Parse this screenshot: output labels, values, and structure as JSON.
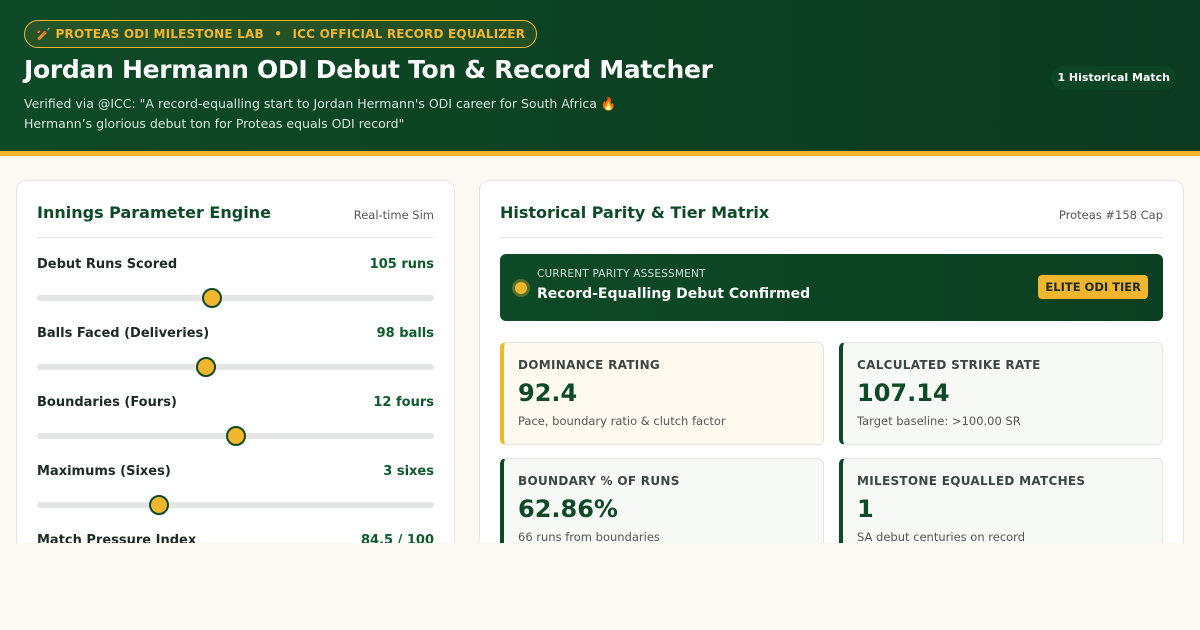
{
  "header": {
    "badge_icon": "🏏",
    "badge_left": "PROTEAS ODI MILESTONE LAB",
    "badge_sep": "•",
    "badge_right": "ICC OFFICIAL RECORD EQUALIZER",
    "title": "Jordan Hermann ODI Debut Ton & Record Matcher",
    "subtitle_line1": "Verified via @ICC: \"A record-equalling start to Jordan Hermann's ODI career for South Africa 🔥",
    "subtitle_line2": "Hermann’s glorious debut ton for Proteas equals ODI record\"",
    "match_count": "1 Historical Match"
  },
  "engine": {
    "title": "Innings Parameter Engine",
    "tag": "Real-time Sim",
    "params": [
      {
        "label": "Debut Runs Scored",
        "value": "105 runs",
        "fraction": 0.44
      },
      {
        "label": "Balls Faced (Deliveries)",
        "value": "98 balls",
        "fraction": 0.425
      },
      {
        "label": "Boundaries (Fours)",
        "value": "12 fours",
        "fraction": 0.5
      },
      {
        "label": "Maximums (Sixes)",
        "value": "3 sixes",
        "fraction": 0.307
      },
      {
        "label": "Match Pressure Index",
        "value": "84.5 / 100",
        "fraction": 0.845
      }
    ]
  },
  "matrix": {
    "title": "Historical Parity & Tier Matrix",
    "tag": "Proteas #158 Cap",
    "parity_label": "CURRENT PARITY ASSESSMENT",
    "parity_status": "Record-Equalling Debut Confirmed",
    "tier": "ELITE ODI TIER",
    "metrics": [
      {
        "label": "DOMINANCE RATING",
        "value": "92.4",
        "caption": "Pace, boundary ratio & clutch factor"
      },
      {
        "label": "CALCULATED STRIKE RATE",
        "value": "107.14",
        "caption": "Target baseline: >100.00 SR"
      },
      {
        "label": "BOUNDARY % OF RUNS",
        "value": "62.86%",
        "caption": "66 runs from boundaries"
      },
      {
        "label": "MILESTONE EQUALLED MATCHES",
        "value": "1",
        "caption": "SA debut centuries on record"
      }
    ]
  },
  "colors": {
    "brand_green": "#0e4a27",
    "accent_gold": "#f2b62e",
    "page_background": "#fcf9f3"
  }
}
